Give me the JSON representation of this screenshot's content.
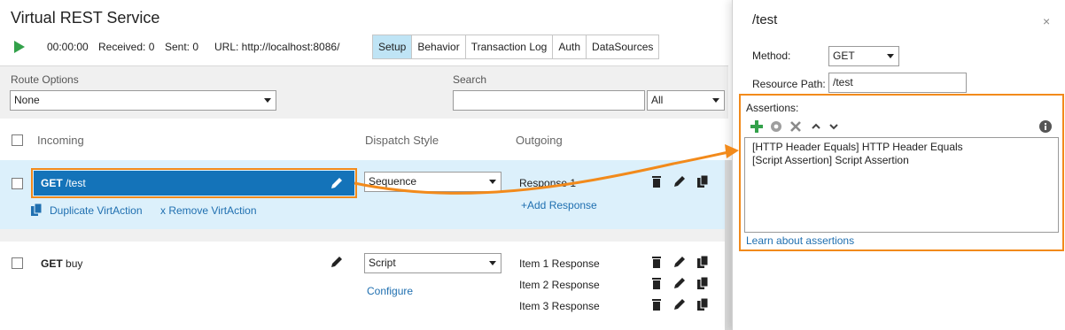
{
  "app": {
    "title": "Virtual REST Service"
  },
  "status": {
    "time": "00:00:00",
    "received": "Received: 0",
    "sent": "Sent: 0",
    "url": "URL: http://localhost:8086/"
  },
  "tabs": [
    {
      "label": "Setup",
      "active": true
    },
    {
      "label": "Behavior"
    },
    {
      "label": "Transaction Log"
    },
    {
      "label": "Auth"
    },
    {
      "label": "DataSources"
    }
  ],
  "filters": {
    "route_options_label": "Route Options",
    "route_options_value": "None",
    "search_label": "Search",
    "search_value": "",
    "search_scope": "All"
  },
  "columns": {
    "incoming": "Incoming",
    "dispatch_style": "Dispatch Style",
    "outgoing": "Outgoing"
  },
  "actions": [
    {
      "method": "GET",
      "path": "/test",
      "dispatch": "Sequence",
      "responses": [
        "Response 1"
      ],
      "add_response": "+Add Response",
      "duplicate": "Duplicate VirtAction",
      "remove": "x Remove VirtAction"
    },
    {
      "method": "GET",
      "path": "buy",
      "dispatch": "Script",
      "configure": "Configure",
      "responses": [
        "Item 1 Response",
        "Item 2 Response",
        "Item 3 Response"
      ]
    }
  ],
  "editor": {
    "title": "/test",
    "close": "×",
    "method_label": "Method:",
    "method_value": "GET",
    "resource_path_label": "Resource Path:",
    "resource_path_value": "/test",
    "assertions_label": "Assertions:",
    "assertions": [
      "[HTTP Header Equals] HTTP Header Equals",
      "[Script Assertion] Script Assertion"
    ],
    "learn_link": "Learn about assertions"
  },
  "colors": {
    "accent": "#f28a1b",
    "selection": "#1473b9",
    "row_highlight": "#dcf0fb",
    "link": "#1f6fb0",
    "play": "#33a14a"
  }
}
